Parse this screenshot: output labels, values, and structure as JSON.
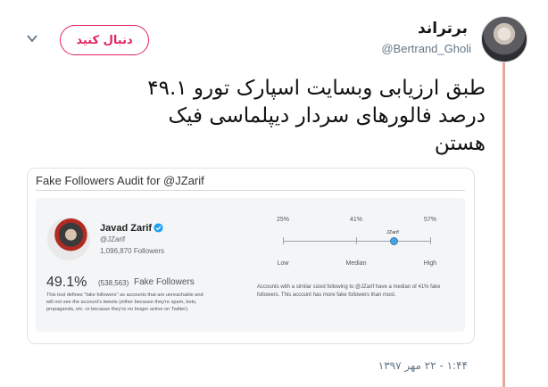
{
  "author": {
    "display_name": "برتراند",
    "handle": "@Bertrand_Gholi",
    "follow_label": "دنبال کنید"
  },
  "tweet": {
    "lines": [
      "طبق ارزیابی وبسایت اسپارک تورو ۴۹.۱",
      "درصد فالورهای سردار دیپلماسی فیک",
      "هستن"
    ],
    "timestamp": "۱:۴۴ - ۲۲ مهر ۱۳۹۷"
  },
  "card": {
    "title": "Fake Followers Audit for @JZarif",
    "account_name": "Javad Zarif",
    "account_handle": "@JZarif",
    "followers": "1,096,870 Followers",
    "fake_percent": "49.1%",
    "fake_count": "(538,563)",
    "fake_label": "Fake Followers",
    "definition": "This tool defines \"fake followers\" as accounts that are unreachable and will not see the account's tweets (either because they're spam, bots, propaganda, etc. or because they're no longer active on Twitter).",
    "scale": {
      "top_labels": [
        "25%",
        "41%",
        "57%"
      ],
      "bottom_labels": [
        "Low",
        "Median",
        "High"
      ],
      "marker_label": "JZarif",
      "marker_value": 0.491,
      "range": [
        0.25,
        0.57
      ]
    },
    "comparison": "Accounts with a similar sized following to @JZarif have a median of 41% fake followers. This account has more fake followers than most."
  },
  "colors": {
    "follow_accent": "#e0245e",
    "thread_line": "#e6a9a0",
    "marker": "#4aa3df",
    "verified": "#1da1f2"
  },
  "icons": [
    "chevron-down-icon",
    "verified-badge-icon"
  ]
}
